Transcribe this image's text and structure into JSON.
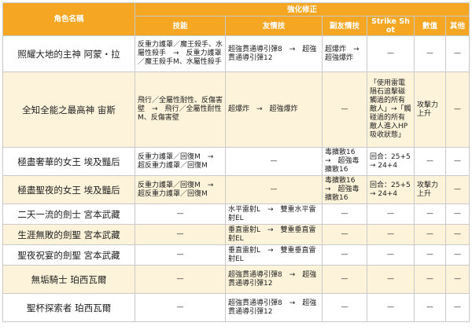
{
  "header": {
    "name_col": "角色名稱",
    "group": "強化修正",
    "cols": [
      "技能",
      "友情技",
      "副友情技",
      "Strike Shot",
      "數值",
      "其他"
    ]
  },
  "rows": [
    {
      "name": "照耀大地的主神 阿蒙・拉",
      "skill": "反重力護罩／魔王殺手、水屬性殺手　→　反重力護罩／魔王殺手M、水屬性殺手",
      "friend": "超強貫通導引彈8　→　超強貫通導引彈12",
      "sub": "超爆炸　→　超強爆炸",
      "ss": "—",
      "stat": "—",
      "other": "—"
    },
    {
      "name": "全知全能之最高神 宙斯",
      "skill": "飛行／全屬性耐性、反傷害壁　→　飛行／全屬性耐性M、反傷害壁",
      "friend": "超爆炸　→　超強爆炸",
      "sub": "—",
      "ss": "「使用雷電隕石追擊磁觸過的所有敵人」→「觸碰過的所有敵人進入HP吸收狀態」",
      "stat": "攻擊力上升",
      "other": "—"
    },
    {
      "name": "極盡奢華的女王 埃及豔后",
      "skill": "反重力護罩／回復M　→　超反重力護罩／回復M",
      "friend": "—",
      "sub": "毒擴散16　→　超強毒擴散16",
      "ss": "回合：25+5　→ 24+4",
      "stat": "—",
      "other": "—"
    },
    {
      "name": "極盡聖夜的女王 埃及豔后",
      "skill": "反重力護罩／回復M　→　超反重力護罩／回復M",
      "friend": "—",
      "sub": "毒擴散16　→　超強毒擴散16",
      "ss": "回合：25+5　→ 24+4",
      "stat": "攻擊力上升",
      "other": "—"
    },
    {
      "name": "二天一流的劍士 宮本武藏",
      "skill": "—",
      "friend": "水平雷射L　→　雙重水平雷射EL",
      "sub": "—",
      "ss": "—",
      "stat": "—",
      "other": "—"
    },
    {
      "name": "生涯無敗的劍聖 宮本武藏",
      "skill": "—",
      "friend": "垂直雷射L　→　雙重垂直雷射EL",
      "sub": "—",
      "ss": "—",
      "stat": "—",
      "other": "—"
    },
    {
      "name": "聖夜祝宴的劍聖 宮本武藏",
      "skill": "—",
      "friend": "垂直雷射L　→　雙重垂直雷射EL",
      "sub": "—",
      "ss": "—",
      "stat": "—",
      "other": "—"
    },
    {
      "name": "無垢騎士 珀西瓦爾",
      "skill": "—",
      "friend": "超強貫通導引彈8　→　超強貫通導引彈12",
      "sub": "—",
      "ss": "—",
      "stat": "—",
      "other": "—"
    },
    {
      "name": "聖杯探索者 珀西瓦爾",
      "skill": "—",
      "friend": "超強貫通導引彈8　→　超強貫通導引彈12",
      "sub": "—",
      "ss": "—",
      "stat": "—",
      "other": "—"
    }
  ]
}
